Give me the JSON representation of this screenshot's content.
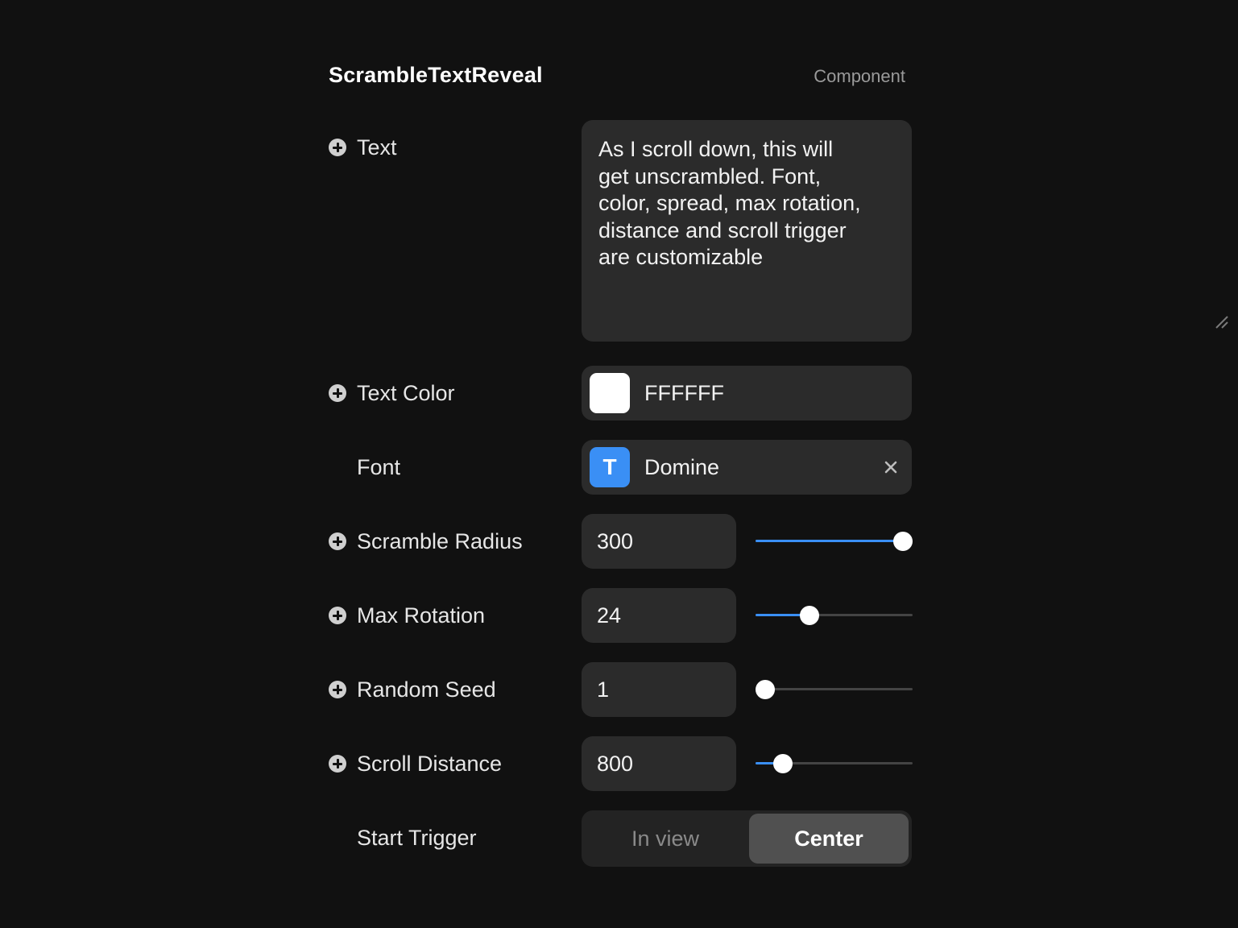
{
  "header": {
    "title": "ScrambleTextReveal",
    "tag": "Component"
  },
  "rows": {
    "text": {
      "label": "Text",
      "value": "As I scroll down, this will\nget unscrambled. Font,\ncolor, spread, max rotation,\ndistance and scroll trigger\nare customizable"
    },
    "text_color": {
      "label": "Text Color",
      "value": "FFFFFF",
      "swatch_color": "#FFFFFF"
    },
    "font": {
      "label": "Font",
      "badge": "T",
      "value": "Domine"
    },
    "scramble_radius": {
      "label": "Scramble Radius",
      "value": "300",
      "slider_fraction": 1.0
    },
    "max_rotation": {
      "label": "Max Rotation",
      "value": "24",
      "slider_fraction": 0.32
    },
    "random_seed": {
      "label": "Random Seed",
      "value": "1",
      "slider_fraction": 0.0
    },
    "scroll_distance": {
      "label": "Scroll Distance",
      "value": "800",
      "slider_fraction": 0.13
    },
    "start_trigger": {
      "label": "Start Trigger",
      "options": [
        "In view",
        "Center"
      ],
      "selected": "Center"
    }
  },
  "colors": {
    "accent": "#3A8FF5",
    "background": "#111111",
    "control": "#2B2B2B"
  }
}
